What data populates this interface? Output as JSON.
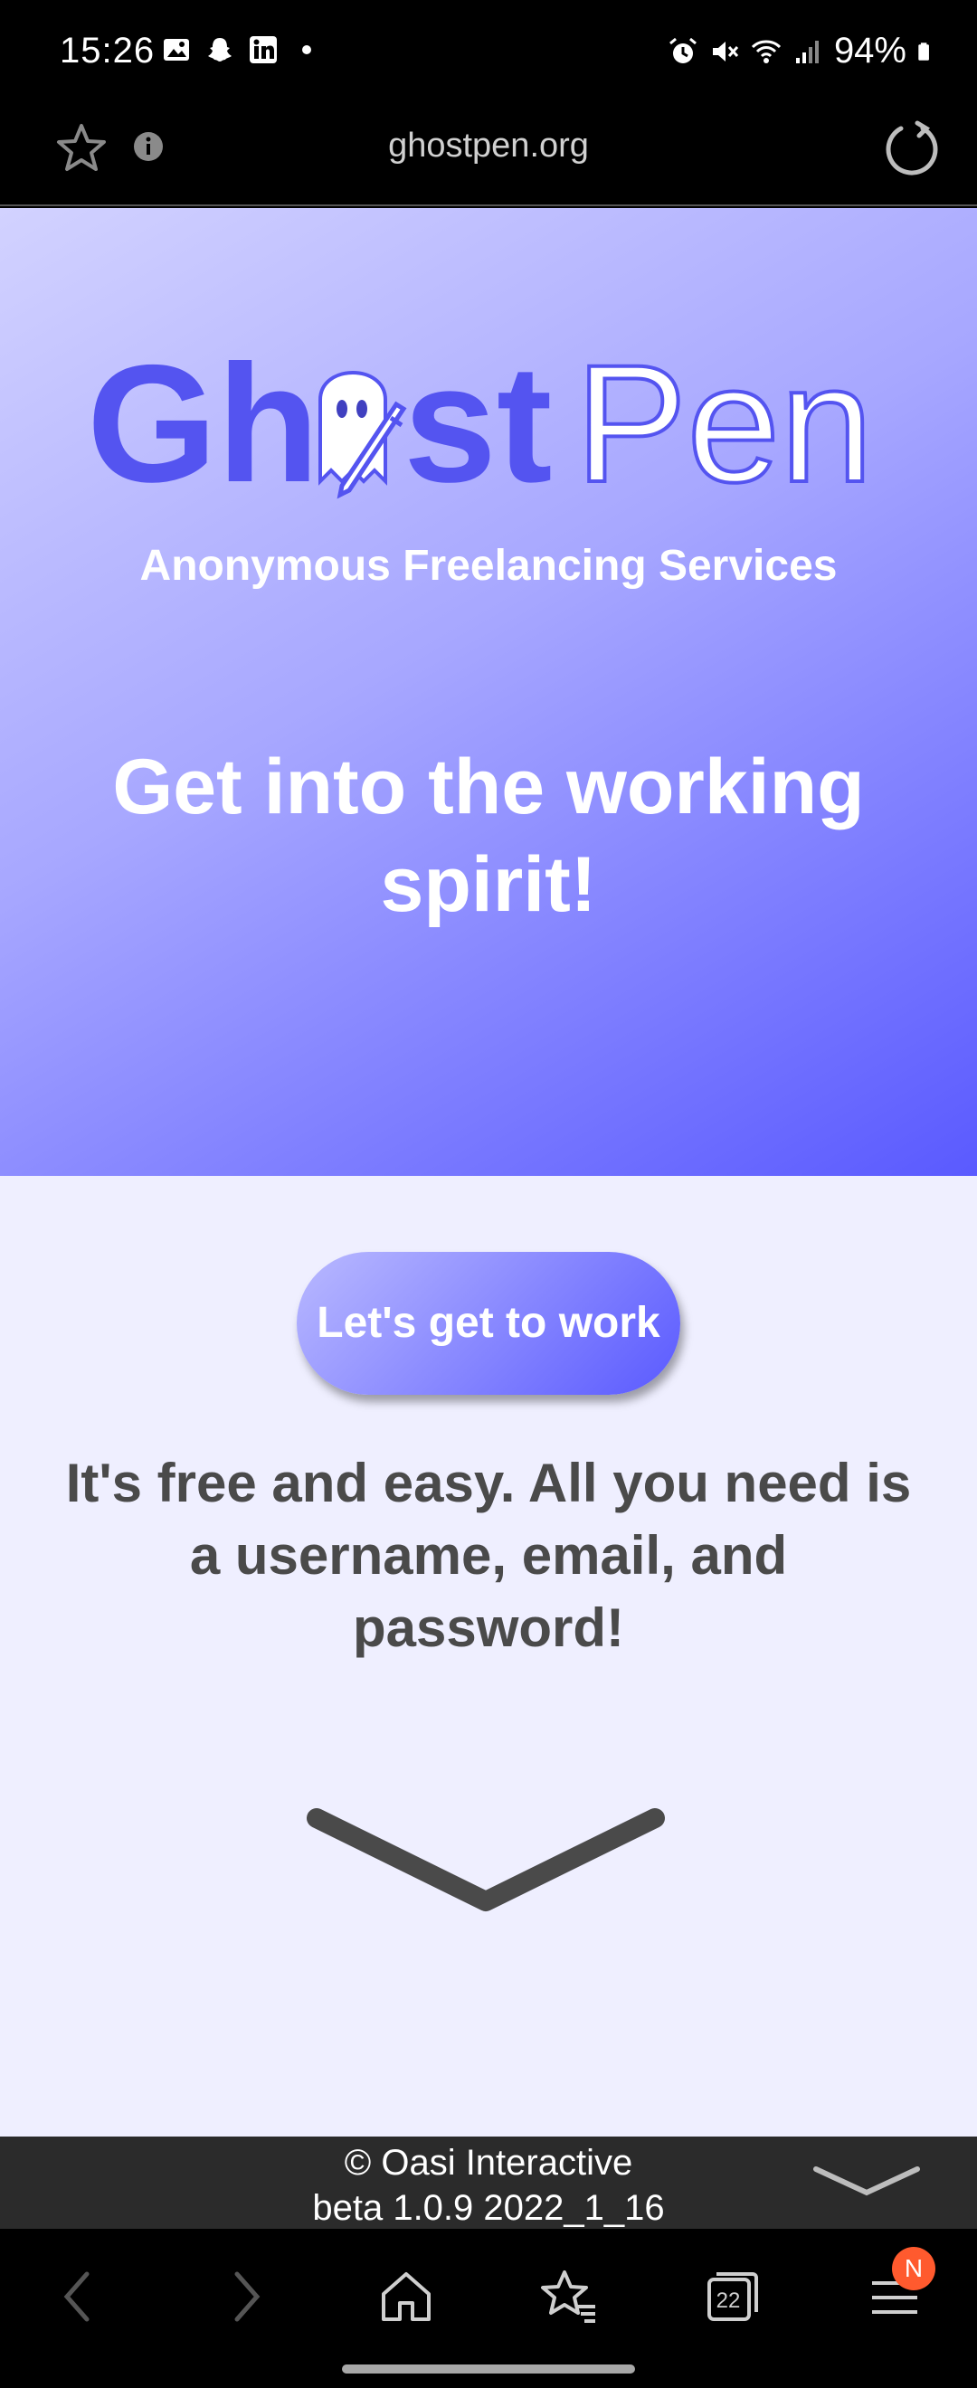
{
  "status_bar": {
    "time": "15:26",
    "battery_percent": "94%",
    "left_icons": [
      "gallery-icon",
      "snapchat-icon",
      "linkedin-icon",
      "dot-icon"
    ],
    "right_icons": [
      "alarm-icon",
      "mute-icon",
      "wifi-icon",
      "signal-icon",
      "battery-icon"
    ]
  },
  "browser": {
    "url": "ghostpen.org",
    "tab_count": "22",
    "menu_badge": "N"
  },
  "hero": {
    "logo_text_left": "Gh",
    "logo_text_mid": "st",
    "logo_text_right": "Pen",
    "tagline": "Anonymous Freelancing Services",
    "heading": "Get into the working spirit!"
  },
  "main": {
    "cta_label": "Let's get to work",
    "info_text": "It's free and easy. All you need is a username, email, and password!"
  },
  "footer": {
    "copyright": "© Oasi Interactive",
    "version": "beta 1.0.9 2022_1_16"
  },
  "colors": {
    "brand": "#5a5aff",
    "hero_light": "#d2d2ff",
    "page_bg": "#efefff",
    "text_dark": "#4a4a4a",
    "footer_bg": "#2b2b2b",
    "badge": "#ff5a2e"
  }
}
